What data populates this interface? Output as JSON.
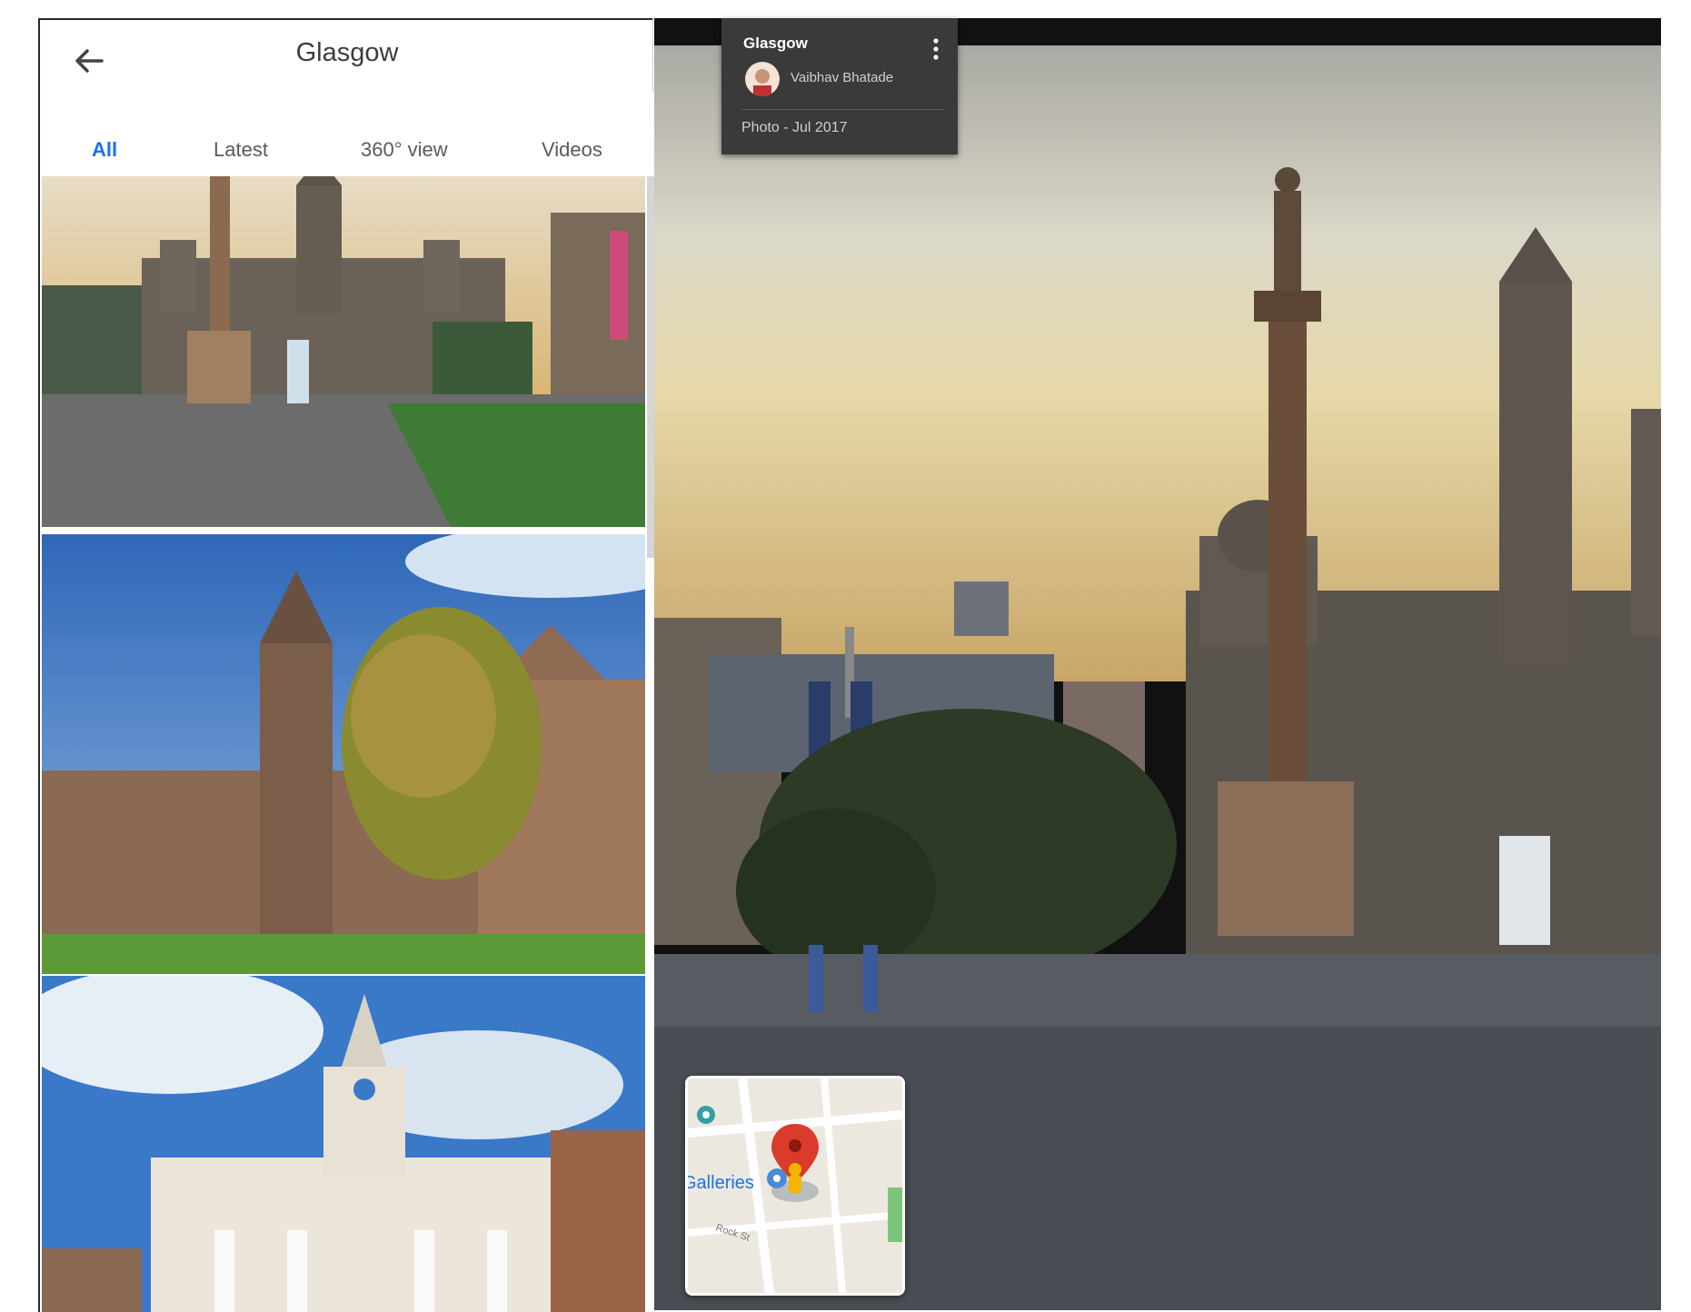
{
  "panel": {
    "title": "Glasgow",
    "tabs": [
      {
        "label": "All",
        "active": true
      },
      {
        "label": "Latest",
        "active": false
      },
      {
        "label": "360° view",
        "active": false
      },
      {
        "label": "Videos",
        "active": false
      }
    ]
  },
  "info_card": {
    "title": "Glasgow",
    "author": "Vaibhav Bhatade",
    "meta": "Photo - Jul 2017"
  },
  "minimap": {
    "label": "Galleries",
    "street": "Rock St"
  },
  "icons": {
    "back": "arrow-left-icon",
    "collapse": "chevron-left-icon",
    "menu": "more-vert-icon",
    "pin": "map-pin-icon",
    "pegman": "pegman-icon"
  },
  "colors": {
    "accent": "#1a73e8",
    "card_bg": "#3a3a3a",
    "pin_red": "#db3b2b"
  }
}
